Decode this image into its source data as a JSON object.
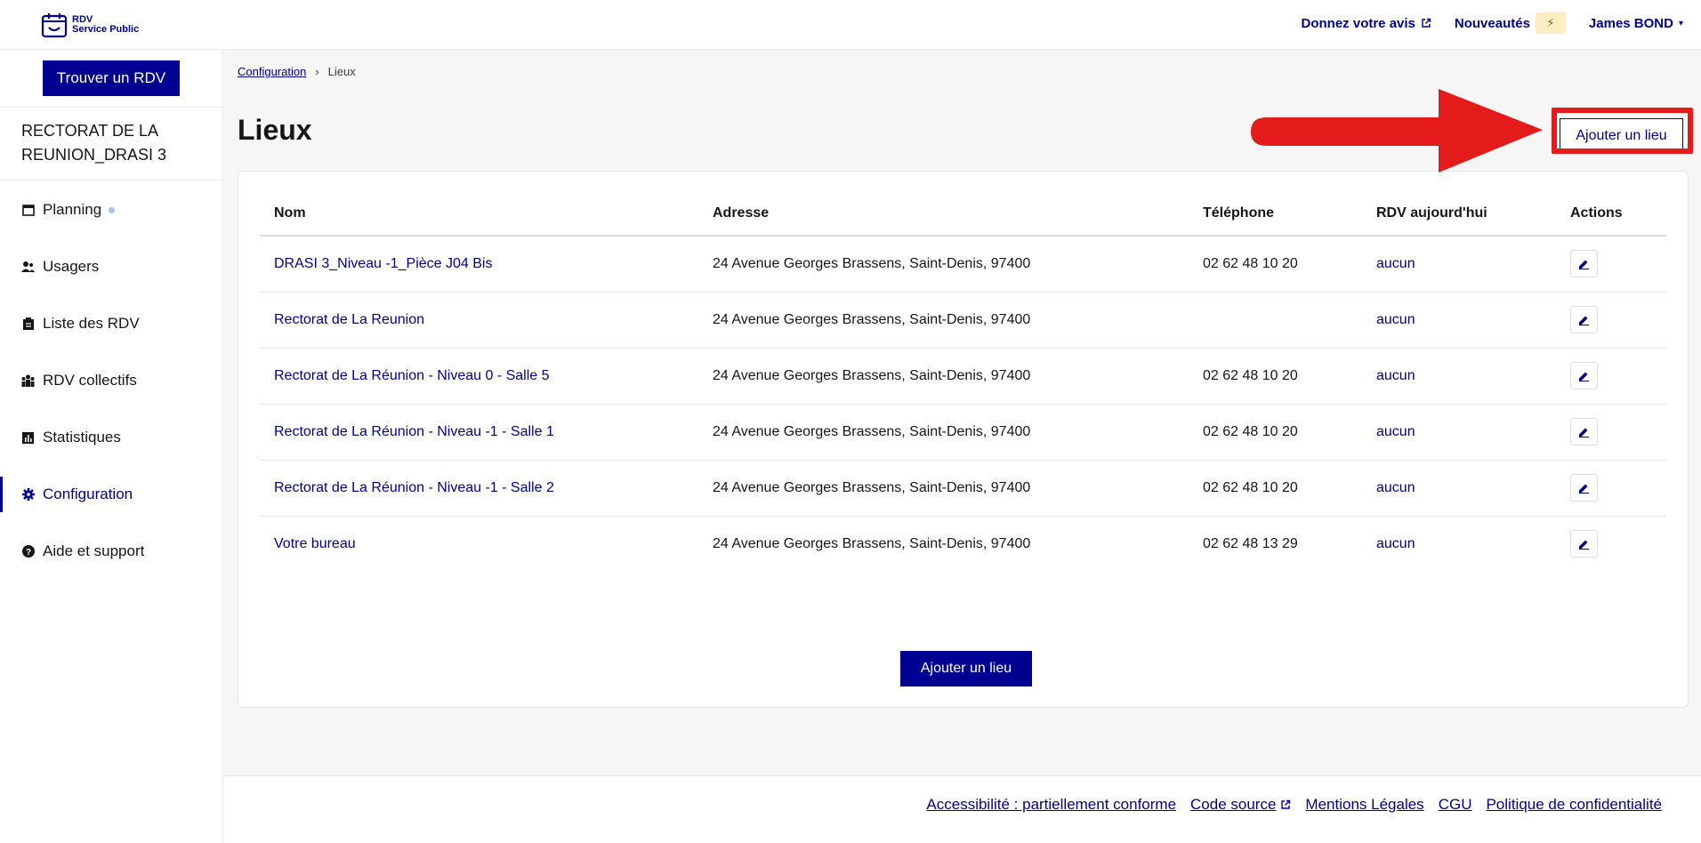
{
  "header": {
    "logo_line1": "RDV",
    "logo_line2": "Service Public",
    "feedback_label": "Donnez votre avis",
    "news_label": "Nouveautés",
    "news_badge": "⚡",
    "user_label": "James BOND",
    "user_caret": "▾"
  },
  "sidebar": {
    "find_button": "Trouver un RDV",
    "org_name": "RECTORAT DE LA REUNION_DRASI 3",
    "items": [
      {
        "label": "Planning",
        "icon": "calendar-icon"
      },
      {
        "label": "Usagers",
        "icon": "users-icon"
      },
      {
        "label": "Liste des RDV",
        "icon": "clipboard-icon"
      },
      {
        "label": "RDV collectifs",
        "icon": "group-icon"
      },
      {
        "label": "Statistiques",
        "icon": "chart-icon"
      },
      {
        "label": "Configuration",
        "icon": "gear-icon"
      },
      {
        "label": "Aide et support",
        "icon": "help-icon"
      }
    ]
  },
  "breadcrumb": {
    "parent": "Configuration",
    "separator": "›",
    "current": "Lieux"
  },
  "page": {
    "title": "Lieux",
    "add_button": "Ajouter un lieu",
    "add_button_bottom": "Ajouter un lieu"
  },
  "table": {
    "headers": [
      "Nom",
      "Adresse",
      "Téléphone",
      "RDV aujourd'hui",
      "Actions"
    ],
    "rows": [
      {
        "name": "DRASI 3_Niveau -1_Pièce J04 Bis",
        "address": "24 Avenue Georges Brassens, Saint-Denis, 97400",
        "phone": "02 62 48 10 20",
        "rdv": "aucun"
      },
      {
        "name": "Rectorat de La Reunion",
        "address": "24 Avenue Georges Brassens, Saint-Denis, 97400",
        "phone": "",
        "rdv": "aucun"
      },
      {
        "name": "Rectorat de La Réunion - Niveau 0 - Salle 5",
        "address": "24 Avenue Georges Brassens, Saint-Denis, 97400",
        "phone": "02 62 48 10 20",
        "rdv": "aucun"
      },
      {
        "name": "Rectorat de La Réunion - Niveau -1 - Salle 1",
        "address": "24 Avenue Georges Brassens, Saint-Denis, 97400",
        "phone": "02 62 48 10 20",
        "rdv": "aucun"
      },
      {
        "name": "Rectorat de La Réunion - Niveau -1 - Salle 2",
        "address": "24 Avenue Georges Brassens, Saint-Denis, 97400",
        "phone": "02 62 48 10 20",
        "rdv": "aucun"
      },
      {
        "name": "Votre bureau",
        "address": "24 Avenue Georges Brassens, Saint-Denis, 97400",
        "phone": "02 62 48 13 29",
        "rdv": "aucun"
      }
    ]
  },
  "footer": {
    "links": [
      "Accessibilité : partiellement conforme",
      "Code source",
      "Mentions Légales",
      "CGU",
      "Politique de confidentialité"
    ]
  },
  "colors": {
    "brand": "#000091",
    "annotation": "#e31b1b"
  }
}
